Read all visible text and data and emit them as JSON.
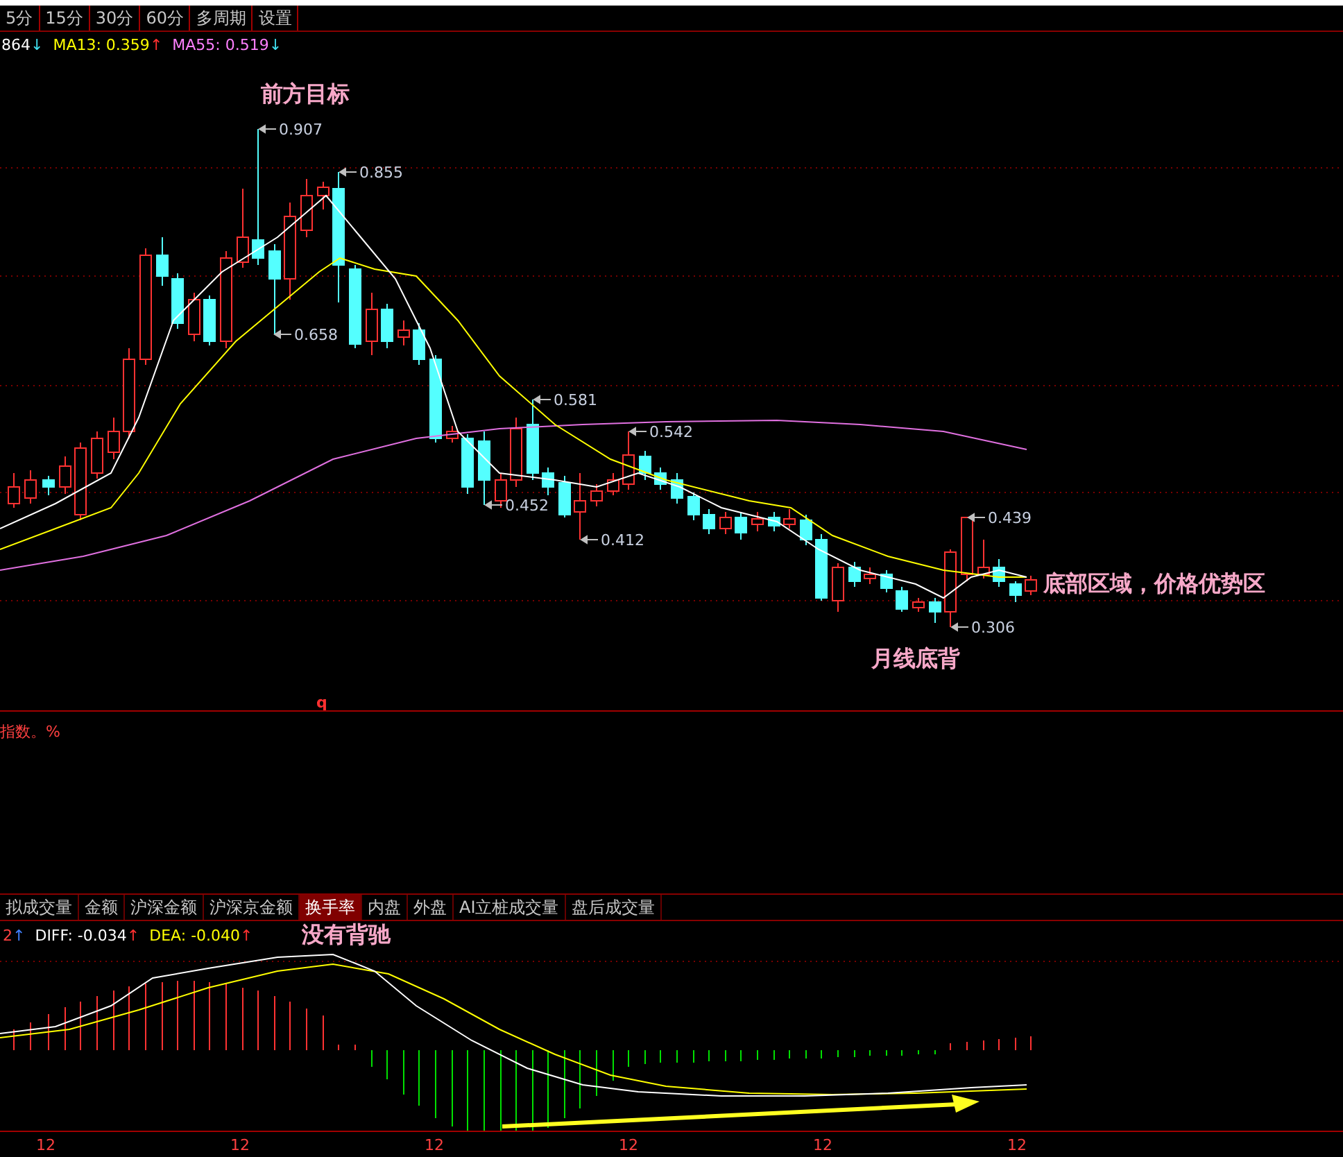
{
  "period_tabs": [
    {
      "label": "5分",
      "selected": false
    },
    {
      "label": "15分",
      "selected": false
    },
    {
      "label": "30分",
      "selected": false
    },
    {
      "label": "60分",
      "selected": false
    },
    {
      "label": "多周期",
      "selected": false
    },
    {
      "label": "设置",
      "selected": false
    }
  ],
  "ma_legend": [
    {
      "text": "864",
      "color": "#ffffff"
    },
    {
      "text": "↓",
      "color": "#40e0f0"
    },
    {
      "text": "MA13: 0.359",
      "color": "#ffff00"
    },
    {
      "text": "↑",
      "color": "#ff3030"
    },
    {
      "text": "MA55: 0.519",
      "color": "#ff80ff"
    },
    {
      "text": "↓",
      "color": "#40e0f0"
    }
  ],
  "main_chart": {
    "price_labels": [
      "0.907",
      "0.855",
      "0.658",
      "0.581",
      "0.542",
      "0.452",
      "0.412",
      "0.439",
      "0.306"
    ],
    "annotations": [
      "前方目标",
      "底部区域，价格优势区",
      "月线底背"
    ],
    "marker": "q"
  },
  "volume_pane": {
    "title": "指数。%"
  },
  "indicator_tabs": [
    {
      "label": "拟成交量",
      "selected": false
    },
    {
      "label": "金额",
      "selected": false
    },
    {
      "label": "沪深金额",
      "selected": false
    },
    {
      "label": "沪深京金额",
      "selected": false
    },
    {
      "label": "换手率",
      "selected": true
    },
    {
      "label": "内盘",
      "selected": false
    },
    {
      "label": "外盘",
      "selected": false
    },
    {
      "label": "AI立桩成交量",
      "selected": false
    },
    {
      "label": "盘后成交量",
      "selected": false
    }
  ],
  "macd": {
    "legend": [
      {
        "text": "2",
        "color": "#ff4040"
      },
      {
        "text": "↑",
        "color": "#4080ff"
      },
      {
        "text": "DIFF: -0.034",
        "color": "#ffffff"
      },
      {
        "text": "↑",
        "color": "#ff3030"
      },
      {
        "text": "DEA: -0.040",
        "color": "#ffff00"
      },
      {
        "text": "↑",
        "color": "#ff3030"
      }
    ],
    "annotation": "没有背驰"
  },
  "time_axis": [
    "12",
    "12",
    "12",
    "12",
    "12",
    "12"
  ]
}
